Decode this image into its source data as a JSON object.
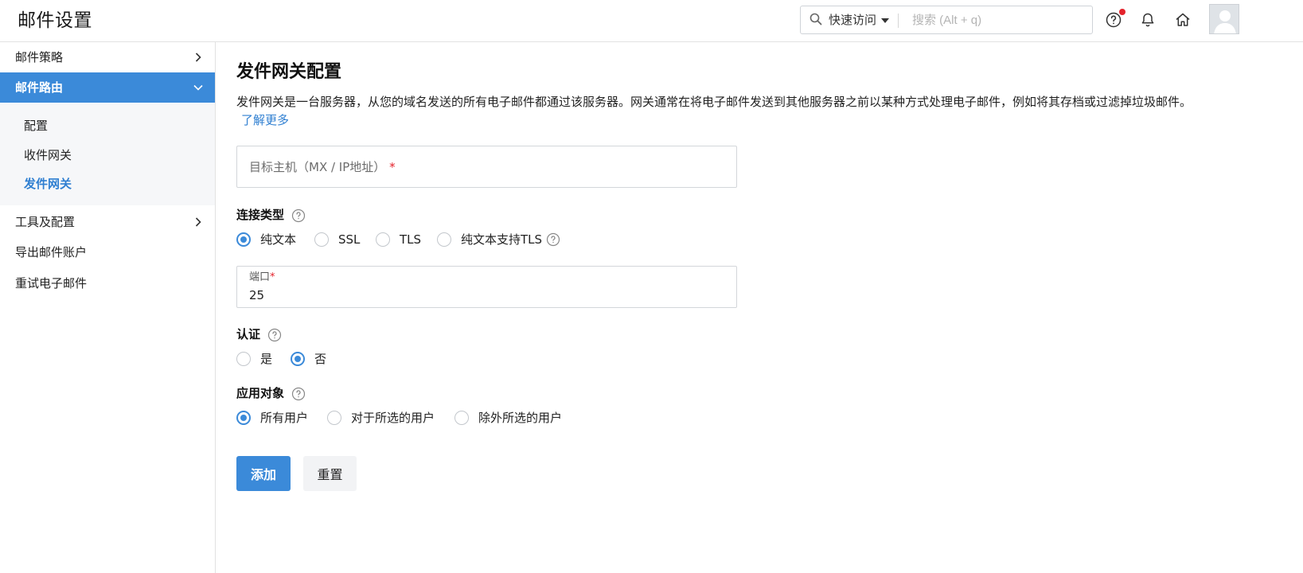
{
  "header": {
    "title": "邮件设置",
    "quick_access": "快速访问",
    "search_placeholder": "搜索 (Alt + q)"
  },
  "sidebar": {
    "items": [
      {
        "label": "邮件策略"
      },
      {
        "label": "邮件路由"
      },
      {
        "label": "工具及配置"
      },
      {
        "label": "导出邮件账户"
      },
      {
        "label": "重试电子邮件"
      }
    ],
    "subitems": [
      {
        "label": "配置"
      },
      {
        "label": "收件网关"
      },
      {
        "label": "发件网关"
      }
    ],
    "active_item": "邮件路由",
    "active_subitem": "发件网关"
  },
  "main": {
    "title": "发件网关配置",
    "description": "发件网关是一台服务器，从您的域名发送的所有电子邮件都通过该服务器。网关通常在将电子邮件发送到其他服务器之前以某种方式处理电子邮件，例如将其存档或过滤掉垃圾邮件。",
    "learn_more": "了解更多",
    "host_placeholder": "目标主机（MX / IP地址）",
    "required_mark": "*",
    "connection": {
      "label": "连接类型",
      "options": [
        "纯文本",
        "SSL",
        "TLS",
        "纯文本支持TLS"
      ],
      "selected": "纯文本"
    },
    "port": {
      "label": "端口",
      "value": "25"
    },
    "auth": {
      "label": "认证",
      "options": [
        "是",
        "否"
      ],
      "selected": "否"
    },
    "apply_to": {
      "label": "应用对象",
      "options": [
        "所有用户",
        "对于所选的用户",
        "除外所选的用户"
      ],
      "selected": "所有用户"
    },
    "buttons": {
      "add": "添加",
      "reset": "重置"
    }
  },
  "colors": {
    "accent": "#3b8ad9",
    "link": "#2f7fd1",
    "required": "#e4222b"
  }
}
